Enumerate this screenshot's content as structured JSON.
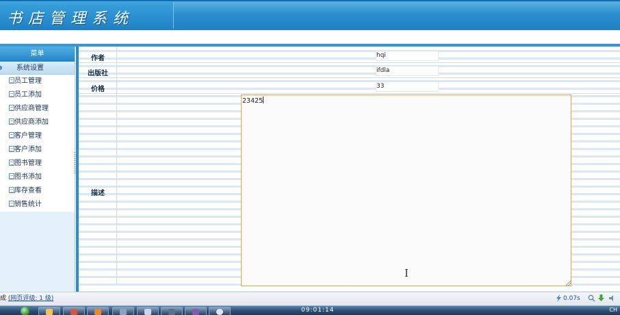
{
  "app": {
    "title": "书店管理系统"
  },
  "sidebar": {
    "menu_title": "菜单",
    "group_label": "系统设置",
    "items": [
      {
        "label": "员工管理"
      },
      {
        "label": "员工添加"
      },
      {
        "label": "供应商管理"
      },
      {
        "label": "供应商添加"
      },
      {
        "label": "客户管理"
      },
      {
        "label": "客户添加"
      },
      {
        "label": "图书管理"
      },
      {
        "label": "图书添加"
      },
      {
        "label": "库存查看"
      },
      {
        "label": "销售统计"
      }
    ]
  },
  "form": {
    "author": {
      "label": "作者",
      "value": "hqi"
    },
    "publisher": {
      "label": "出版社",
      "value": "ifdla"
    },
    "price": {
      "label": "价格",
      "value": "33"
    },
    "description": {
      "label": "描述",
      "value": "23425"
    }
  },
  "statusbar": {
    "left_prefix": "成",
    "rating_link": "(网页评级: 1 级)",
    "timing": "0.07s"
  },
  "taskbar": {
    "clock": "09:01:14",
    "tray_text": "CH"
  },
  "colors": {
    "header_blue": "#2c8fcf",
    "sidebar_bg": "#e4f1fa",
    "textarea_border": "#e3a53c"
  }
}
